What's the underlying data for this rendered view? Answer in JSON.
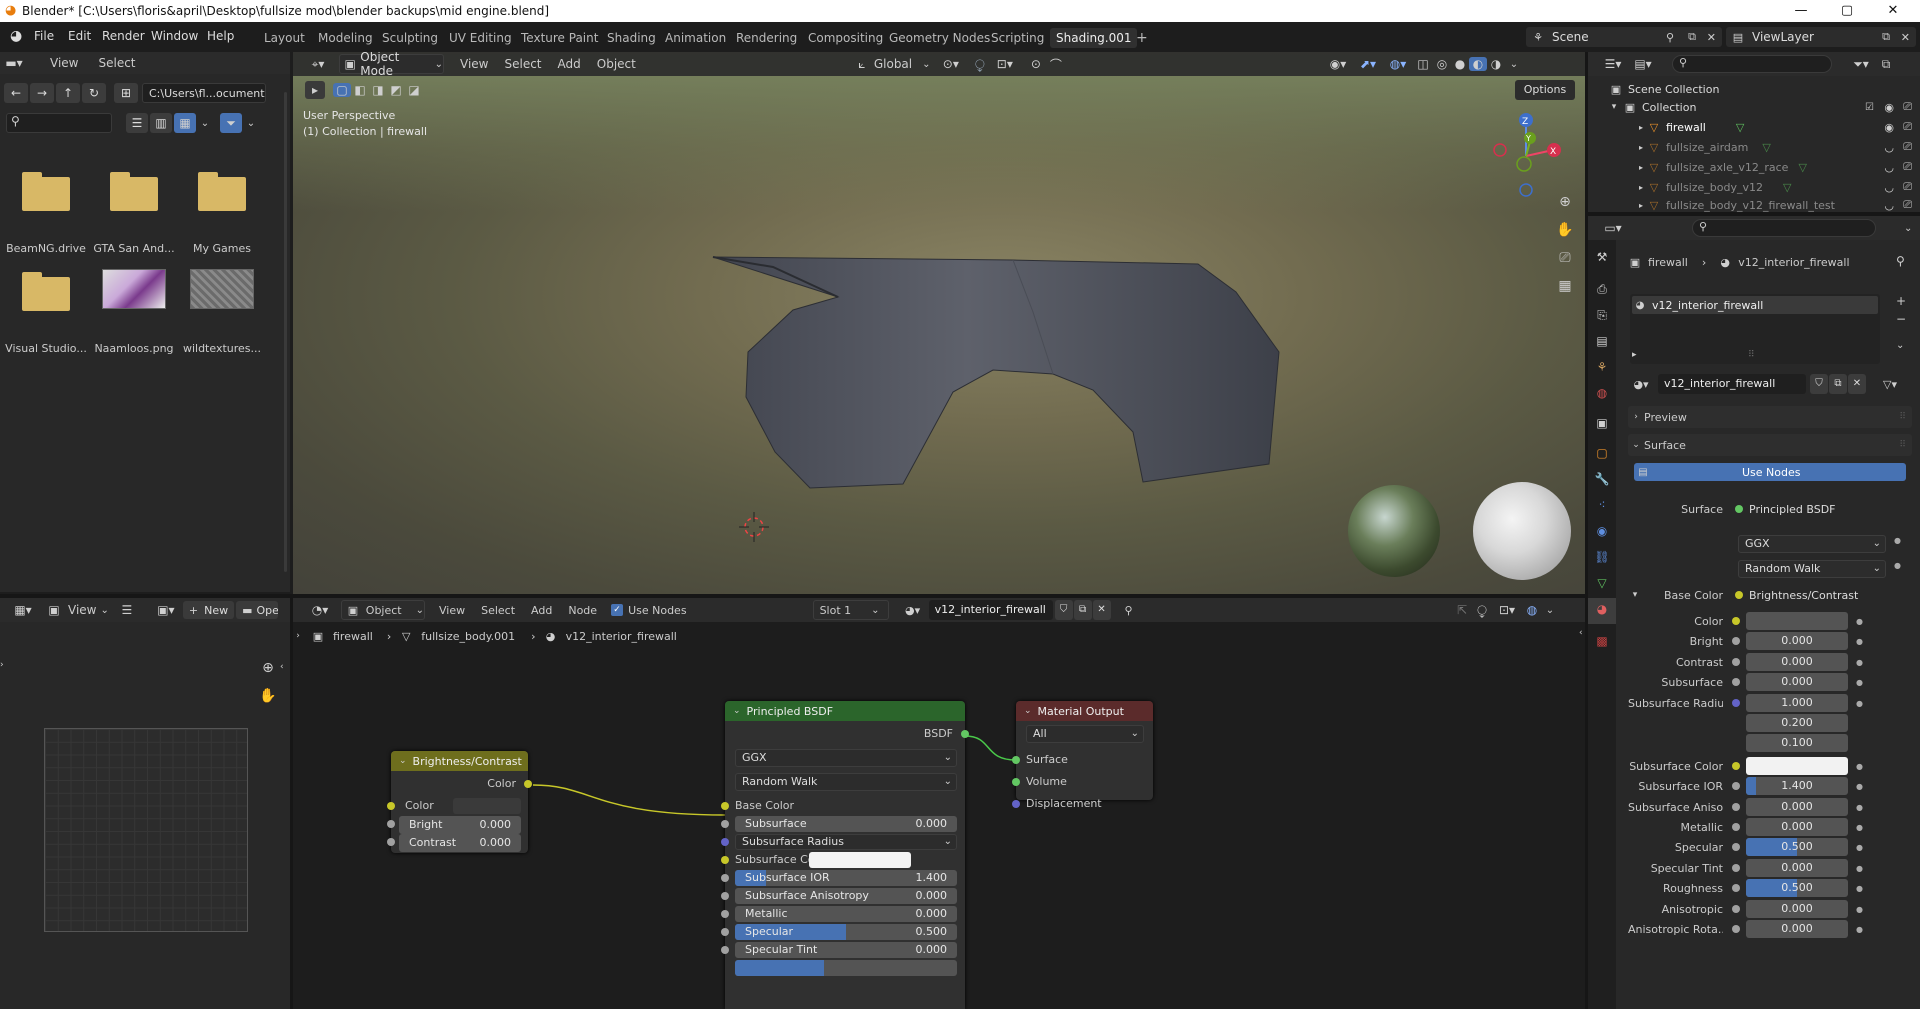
{
  "window": {
    "title": "Blender* [C:\\Users\\floris&april\\Desktop\\fullsize mod\\blender backups\\mid engine.blend]",
    "minimize": "—",
    "maximize": "▢",
    "close": "✕"
  },
  "menu": {
    "items": [
      "File",
      "Edit",
      "Render",
      "Window",
      "Help"
    ]
  },
  "workspaces": [
    "Layout",
    "Modeling",
    "Sculpting",
    "UV Editing",
    "Texture Paint",
    "Shading",
    "Animation",
    "Rendering",
    "Compositing",
    "Geometry Nodes",
    "Scripting",
    "Shading.001"
  ],
  "workspace_add": "+",
  "scene": {
    "label": "Scene",
    "view_layer": "ViewLayer"
  },
  "file_browser": {
    "menu": [
      "View",
      "Select"
    ],
    "path": "C:\\Users\\fl...ocuments\\",
    "items": [
      {
        "name": "BeamNG.drive",
        "kind": "folder"
      },
      {
        "name": "GTA San And...",
        "kind": "folder"
      },
      {
        "name": "My Games",
        "kind": "folder"
      },
      {
        "name": "Visual Studio...",
        "kind": "folder"
      },
      {
        "name": "Naamloos.png",
        "kind": "image"
      },
      {
        "name": "wildtextures...",
        "kind": "image"
      }
    ]
  },
  "viewport": {
    "mode": "Object Mode",
    "menu": [
      "View",
      "Select",
      "Add",
      "Object"
    ],
    "transform": "Global",
    "options": "Options",
    "overlay_text": [
      "User Perspective",
      "(1) Collection | firewall"
    ],
    "gizmo": {
      "x": "X",
      "y": "Y",
      "z": "Z"
    }
  },
  "outliner": {
    "root": "Scene Collection",
    "collection": "Collection",
    "items": [
      "firewall",
      "fullsize_airdam",
      "fullsize_axle_v12_race",
      "fullsize_body_v12",
      "fullsize_body_v12_firewall_test"
    ]
  },
  "image_editor": {
    "view": "View",
    "new": "New",
    "open": "Open"
  },
  "node_editor": {
    "type": "Object",
    "menu": [
      "View",
      "Select",
      "Add",
      "Node"
    ],
    "use_nodes": "Use Nodes",
    "slot": "Slot 1",
    "material": "v12_interior_firewall",
    "breadcrumb": [
      "firewall",
      "fullsize_body.001",
      "v12_interior_firewall"
    ],
    "brightness_node": {
      "title": "Brightness/Contrast",
      "output": "Color",
      "inputs": [
        {
          "label": "Color"
        },
        {
          "label": "Bright",
          "value": "0.000"
        },
        {
          "label": "Contrast",
          "value": "0.000"
        }
      ]
    },
    "bsdf_node": {
      "title": "Principled BSDF",
      "output": "BSDF",
      "distribution": "GGX",
      "sss_method": "Random Walk",
      "inputs": [
        {
          "label": "Base Color"
        },
        {
          "label": "Subsurface",
          "value": "0.000"
        },
        {
          "label": "Subsurface Radius",
          "dropdown": true
        },
        {
          "label": "Subsurface Color",
          "white": true
        },
        {
          "label": "Subsurface IOR",
          "value": "1.400",
          "fill": 0.14
        },
        {
          "label": "Subsurface Anisotropy",
          "value": "0.000"
        },
        {
          "label": "Metallic",
          "value": "0.000"
        },
        {
          "label": "Specular",
          "value": "0.500",
          "fill": 0.5
        },
        {
          "label": "Specular Tint",
          "value": "0.000"
        }
      ]
    },
    "output_node": {
      "title": "Material Output",
      "target": "All",
      "inputs": [
        "Surface",
        "Volume",
        "Displacement"
      ]
    }
  },
  "properties": {
    "breadcrumb": [
      "firewall",
      "v12_interior_firewall"
    ],
    "slot_item": "v12_interior_firewall",
    "material_name": "v12_interior_firewall",
    "preview": "Preview",
    "surface_panel": "Surface",
    "use_nodes": "Use Nodes",
    "surface_label": "Surface",
    "surface_value": "Principled BSDF",
    "distribution": "GGX",
    "sss_method": "Random Walk",
    "base_color_label": "Base Color",
    "base_color_value": "Brightness/Contrast",
    "rows": [
      {
        "label": "Color",
        "value": "",
        "dot": "ylw"
      },
      {
        "label": "Bright",
        "value": "0.000",
        "dot": "gry"
      },
      {
        "label": "Contrast",
        "value": "0.000",
        "dot": "gry"
      },
      {
        "label": "Subsurface",
        "value": "0.000",
        "dot": "gry"
      },
      {
        "label": "Subsurface Radius",
        "value": "1.000",
        "dot": "blu"
      },
      {
        "label": "",
        "value": "0.200",
        "dot": ""
      },
      {
        "label": "",
        "value": "0.100",
        "dot": ""
      },
      {
        "label": "Subsurface Color",
        "value": "",
        "dot": "ylw",
        "white": true
      },
      {
        "label": "Subsurface IOR",
        "value": "1.400",
        "dot": "gry",
        "fill": 0.1
      },
      {
        "label": "Subsurface Aniso...",
        "value": "0.000",
        "dot": "gry"
      },
      {
        "label": "Metallic",
        "value": "0.000",
        "dot": "gry"
      },
      {
        "label": "Specular",
        "value": "0.500",
        "dot": "gry",
        "fill": 0.5
      },
      {
        "label": "Specular Tint",
        "value": "0.000",
        "dot": "gry"
      },
      {
        "label": "Roughness",
        "value": "0.500",
        "dot": "gry",
        "fill": 0.5
      },
      {
        "label": "Anisotropic",
        "value": "0.000",
        "dot": "gry"
      },
      {
        "label": "Anisotropic Rota...",
        "value": "0.000",
        "dot": "gry"
      }
    ]
  },
  "colors": {
    "accent": "#4772b3",
    "bsdf_header": "#2b652b",
    "brightness_header": "#6e6e1d",
    "output_header": "#5b2b2b",
    "yellow_socket": "#c7c729"
  }
}
